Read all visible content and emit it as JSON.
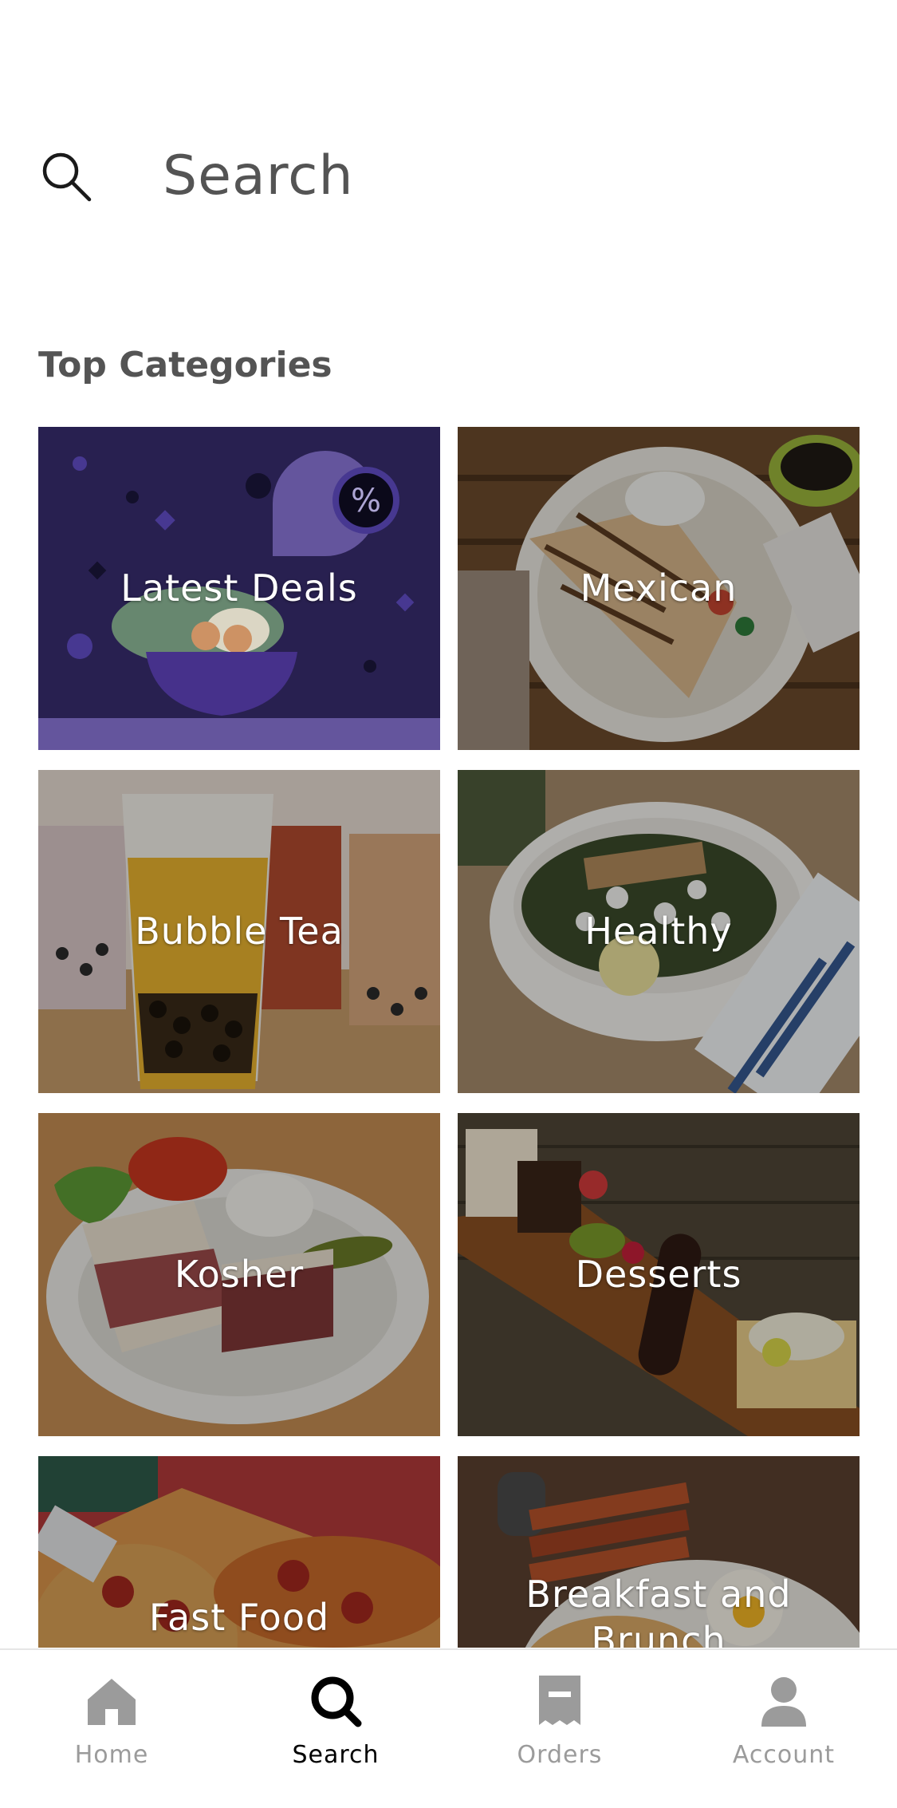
{
  "search": {
    "placeholder": "Search"
  },
  "top_categories": {
    "title": "Top Categories",
    "items": [
      {
        "label": "Latest Deals"
      },
      {
        "label": "Mexican"
      },
      {
        "label": "Bubble Tea"
      },
      {
        "label": "Healthy"
      },
      {
        "label": "Kosher"
      },
      {
        "label": "Desserts"
      },
      {
        "label": "Fast Food"
      },
      {
        "label": "Breakfast and Brunch"
      }
    ]
  },
  "tab_bar": {
    "items": [
      {
        "label": "Home",
        "icon": "home-icon",
        "active": false
      },
      {
        "label": "Search",
        "icon": "search-icon",
        "active": true
      },
      {
        "label": "Orders",
        "icon": "receipt-icon",
        "active": false
      },
      {
        "label": "Account",
        "icon": "person-icon",
        "active": false
      }
    ]
  },
  "colors": {
    "deals_purple": "#2b2255",
    "accent_purple": "#4a3493",
    "active_tab": "#000000",
    "inactive_tab": "#9b9b9b"
  }
}
